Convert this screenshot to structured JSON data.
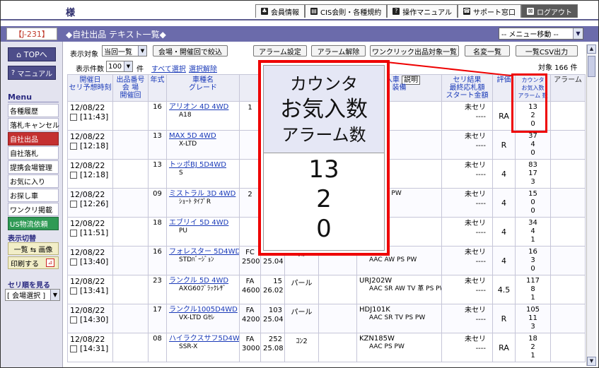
{
  "header": {
    "user_suffix": "様",
    "nav": [
      {
        "icon": "♣",
        "label": "会員情報"
      },
      {
        "icon": "▤",
        "label": "CIS会則・各種規約"
      },
      {
        "icon": "?",
        "label": "操作マニュアル"
      },
      {
        "icon": "☎",
        "label": "サポート窓口"
      },
      {
        "icon": "⊠",
        "label": "ログアウト"
      }
    ]
  },
  "titlebar": {
    "code": "【J-231】",
    "title": "◆自社出品 テキスト一覧◆",
    "menu_move": "-- メニュー移動 --"
  },
  "sidebar": {
    "top_button": "TOPへ",
    "manual_button": "マニュアル",
    "menu_header": "Menu",
    "items": [
      "各種履歴",
      "落札キャンセル",
      "自社出品",
      "自社落札",
      "提携会場管理",
      "お気に入り",
      "お探し車",
      "ワンクリ掲載",
      "US物流依頼"
    ],
    "display_switch_header": "表示切替",
    "display_switch": "一覧 ⇆ 画像",
    "print_label": "印刷する",
    "sort_header": "セリ順を見る",
    "sort_select": "[ 会場選択 ]"
  },
  "controls": {
    "display_target_label": "表示対象",
    "display_target_value": "当回一覧",
    "filter_button": "会場・開催回で絞込",
    "alarm_set": "アラーム設定",
    "alarm_clear": "アラーム解除",
    "oneclick_list": "ワンクリック出品対象一覧",
    "name_change_list": "名変一覧",
    "csv_export": "一覧CSV出力",
    "per_page_label": "表示件数",
    "per_page_value": "100",
    "per_page_unit": "件",
    "select_all": "すべて選択",
    "clear_selection": "選択解除",
    "total_count": "対象 166 件"
  },
  "table": {
    "headers": {
      "date": [
        "開催日",
        "セリ予想時刻"
      ],
      "lot": [
        "出品番号",
        "会 場",
        "開催回"
      ],
      "year": "年式",
      "car": [
        "車種名",
        "グレード"
      ],
      "import": [
        "輸入車",
        "装備"
      ],
      "import_button": "説明",
      "result": [
        "セリ結果",
        "最終応札額",
        "スタート金額"
      ],
      "rating": "評価",
      "counts": [
        "カウンタ",
        "お気入数",
        "アラーム 数"
      ],
      "alarm": "アラーム"
    },
    "rows": [
      {
        "date": "12/08/22",
        "time": "[11:43]",
        "year": "16",
        "car": "アリオン 4D 4WD",
        "grade": "A18",
        "shift": "",
        "cc": "1",
        "mileage": "",
        "km": "",
        "color": "",
        "model": "",
        "equip": "PW",
        "result": "未セリ",
        "bid": "----",
        "rating": "RA",
        "counter": "13",
        "fav": "2",
        "alarm": "0"
      },
      {
        "date": "12/08/22",
        "time": "[12:18]",
        "year": "13",
        "car": "MAX 5D 4WD",
        "grade": "X-LTD",
        "shift": "",
        "cc": "",
        "mileage": "",
        "km": "",
        "color": "",
        "model": "",
        "equip": "S PW",
        "result": "未セリ",
        "bid": "----",
        "rating": "R",
        "counter": "37",
        "fav": "4",
        "alarm": "0"
      },
      {
        "date": "12/08/22",
        "time": "[12:18]",
        "year": "13",
        "car": "トッポBJ 5D4WD",
        "grade": "S",
        "shift": "",
        "cc": "",
        "mileage": "",
        "km": "",
        "color": "",
        "model": "",
        "equip": "W",
        "result": "未セリ",
        "bid": "----",
        "rating": "4",
        "counter": "83",
        "fav": "17",
        "alarm": "3"
      },
      {
        "date": "12/08/22",
        "time": "[12:26]",
        "year": "09",
        "car": "ミストラル 3D 4WD",
        "grade": "ｼｮｰﾄ ﾀｲﾌﾟR",
        "shift": "",
        "cc": "2",
        "mileage": "",
        "km": "",
        "color": "",
        "model": "",
        "equip": "AW PS PW",
        "result": "未セリ",
        "bid": "----",
        "rating": "4",
        "counter": "15",
        "fav": "0",
        "alarm": "0"
      },
      {
        "date": "12/08/22",
        "time": "[11:51]",
        "year": "18",
        "car": "エブリイ 5D 4WD",
        "grade": "PU",
        "shift": "",
        "cc": "",
        "mileage": "",
        "km": "",
        "color": "",
        "model": "",
        "equip": "",
        "result": "未セリ",
        "bid": "----",
        "rating": "4",
        "counter": "34",
        "fav": "4",
        "alarm": "1"
      },
      {
        "date": "12/08/22",
        "time": "[13:40]",
        "year": "16",
        "car": "フォレスター 5D4WD",
        "grade": "STDﾊﾞｰｼﾞｮﾝ",
        "shift": "FC",
        "cc": "2500",
        "mileage": "93",
        "km": "25.04",
        "color": "ｼﾙ",
        "model": "SG9",
        "equip": "AAC AW PS PW",
        "result": "未セリ",
        "bid": "----",
        "rating": "4",
        "counter": "16",
        "fav": "3",
        "alarm": "0"
      },
      {
        "date": "12/08/22",
        "time": "[13:41]",
        "year": "23",
        "car": "ランクル 5D 4WD",
        "grade": "AXG60ﾌﾞﾗｯｸﾚｻﾞ",
        "shift": "FA",
        "cc": "4600",
        "mileage": "15",
        "km": "26.02",
        "color": "パール",
        "model": "URJ202W",
        "equip": "AAC SR AW TV 革 PS PW",
        "result": "未セリ",
        "bid": "----",
        "rating": "4.5",
        "counter": "117",
        "fav": "8",
        "alarm": "1"
      },
      {
        "date": "12/08/22",
        "time": "[14:30]",
        "year": "17",
        "car": "ランクル1005D4WD",
        "grade": "VX-LTD Gｾﾚ",
        "shift": "FA",
        "cc": "4200",
        "mileage": "103",
        "km": "25.04",
        "color": "パール",
        "model": "HDJ101K",
        "equip": "AAC SR TV PS PW",
        "result": "未セリ",
        "bid": "----",
        "rating": "R",
        "counter": "105",
        "fav": "11",
        "alarm": "3"
      },
      {
        "date": "12/08/22",
        "time": "[14:31]",
        "year": "08",
        "car": "ハイラクスサフ5D4WD",
        "grade": "SSR-X",
        "shift": "FA",
        "cc": "3000",
        "mileage": "252",
        "km": "25.08",
        "color": "ｺﾝ2",
        "model": "KZN185W",
        "equip": "AAC PS PW",
        "result": "未セリ",
        "bid": "----",
        "rating": "RA",
        "counter": "18",
        "fav": "2",
        "alarm": "1"
      }
    ]
  },
  "callout": {
    "title_lines": [
      "カウンタ",
      "お気入数",
      "アラーム数"
    ],
    "values": [
      "13",
      "2",
      "0"
    ]
  },
  "colors": {
    "highlight": "#e00000",
    "title_band": "#6b6bab",
    "link": "#1a3ab8"
  }
}
